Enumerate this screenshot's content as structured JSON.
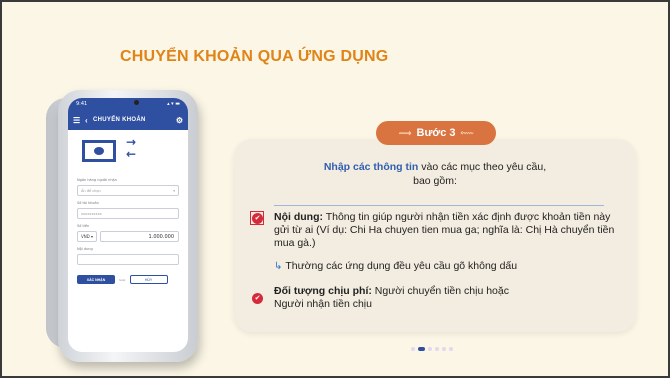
{
  "slide": {
    "title": "CHUYỂN KHOẢN QUA ỨNG DỤNG"
  },
  "phone": {
    "status_time": "9:41",
    "status_icons": "▴ ▾ ▬",
    "app_title": "CHUYỂN KHOẢN",
    "menu_icon": "hamburger-icon",
    "back_icon": "chevron-left-icon",
    "settings_icon": "gear-icon",
    "fields": [
      {
        "label": "Ngân hàng người nhận",
        "value": "Ấn để chọn"
      },
      {
        "label": "Số tài khoản",
        "value": "xxxxxxxxxx"
      },
      {
        "label": "Số tiền",
        "currency": "VND ▾",
        "amount": "1.000.000"
      },
      {
        "label": "Nội dung",
        "value": ""
      }
    ],
    "next_button": "XÁC NHẬN",
    "or_text": "hoặc",
    "cancel_button": "HỦY"
  },
  "card": {
    "step_label": "Bước 3",
    "intro_highlight": "Nhập các thông tin",
    "intro_rest": " vào các mục theo yêu cầu,",
    "intro_line2": "bao gồm:",
    "item1_title": "Nội dung:",
    "item1_text": " Thông tin giúp người nhận tiền xác định được khoản tiền này gửi từ ai (Ví dụ: Chi Ha chuyen tien mua ga; nghĩa là: Chị Hà chuyển tiền mua gà.)",
    "note": "Thường các ứng dụng đều yêu cầu gõ không dấu",
    "item2_title": "Đối tượng chịu phí:",
    "item2_text": " Người chuyển tiền chịu hoặc",
    "item2_line2": "Người nhận tiền chịu"
  },
  "pagination": {
    "active_index": 1,
    "count": 6
  },
  "colors": {
    "title": "#e08418",
    "step": "#d9733f",
    "accent_blue": "#2f5fb0",
    "bullet": "#d42a3a",
    "app_bar": "#2f4fa0"
  }
}
